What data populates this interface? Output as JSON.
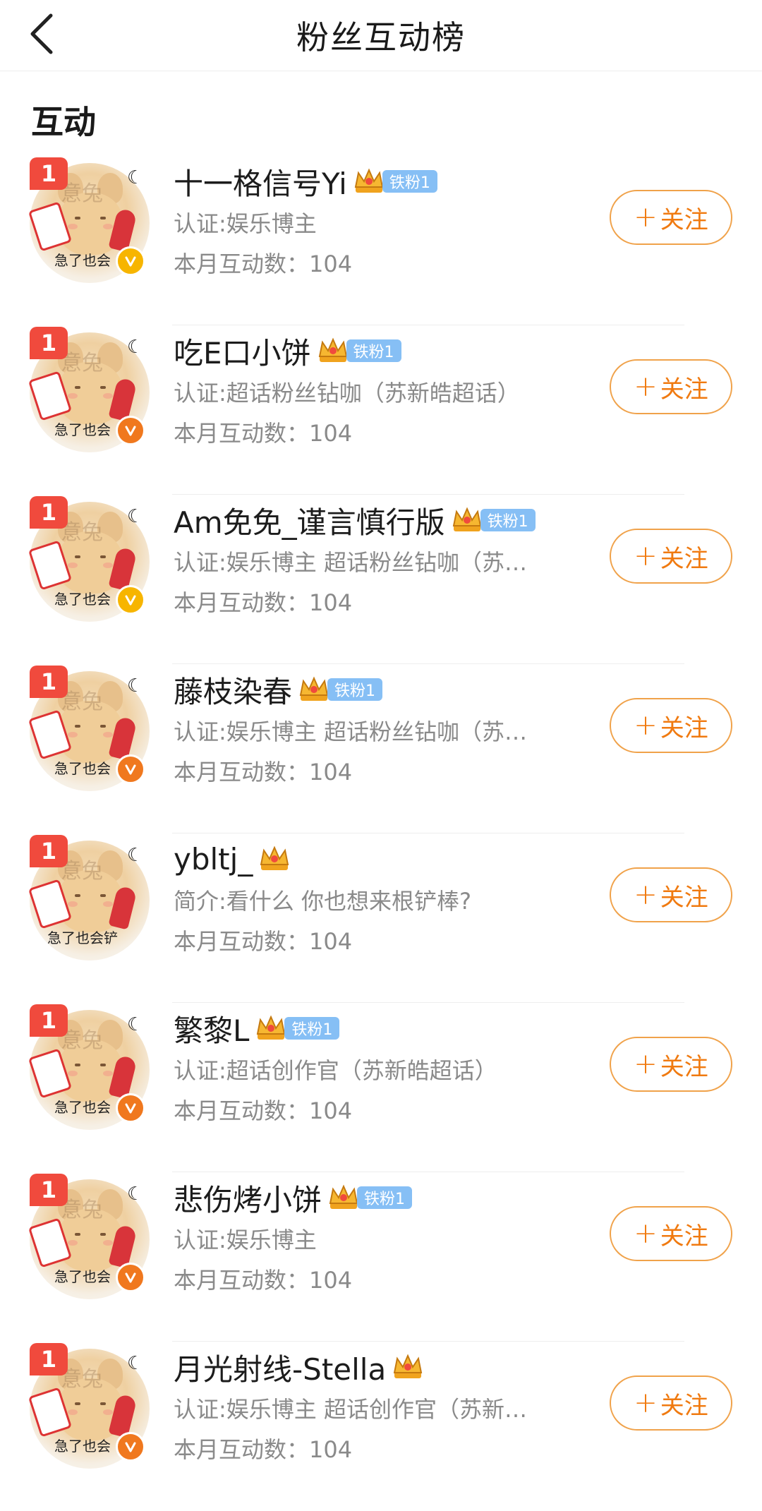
{
  "header": {
    "title": "粉丝互动榜"
  },
  "section": {
    "title": "互动"
  },
  "colors": {
    "accent": "#f07a10",
    "rank": "#f04a3d",
    "fan_tag": "#86bff5"
  },
  "follow_label": "关注",
  "items": [
    {
      "rank": "1",
      "avatar_caption": "急了也会",
      "avatar_watermark": "意兔",
      "verified_color": "gold",
      "name": "十一格信号Yi",
      "crown": "crown-icon",
      "fan_tag": "铁粉1",
      "desc": "认证:娱乐博主",
      "count": "本月互动数：104"
    },
    {
      "rank": "1",
      "avatar_caption": "急了也会",
      "avatar_watermark": "意兔",
      "verified_color": "orange",
      "name": "吃E口小饼",
      "crown": "crown-icon",
      "fan_tag": "铁粉1",
      "desc": "认证:超话粉丝钻咖（苏新皓超话）",
      "count": "本月互动数：104"
    },
    {
      "rank": "1",
      "avatar_caption": "急了也会",
      "avatar_watermark": "意兔",
      "verified_color": "gold",
      "name": "Am免免_谨言慎行版",
      "crown": "crown-icon",
      "fan_tag": "铁粉1",
      "desc": "认证:娱乐博主 超话粉丝钻咖（苏…",
      "count": "本月互动数：104"
    },
    {
      "rank": "1",
      "avatar_caption": "急了也会",
      "avatar_watermark": "意兔",
      "verified_color": "orange",
      "name": "藤枝染春",
      "crown": "crown-icon",
      "fan_tag": "铁粉1",
      "desc": "认证:娱乐博主 超话粉丝钻咖（苏…",
      "count": "本月互动数：104"
    },
    {
      "rank": "1",
      "avatar_caption": "急了也会铲",
      "avatar_watermark": "意兔",
      "verified_color": "none",
      "name": "ybltj_",
      "crown": "crown-icon",
      "fan_tag": "",
      "desc": "简介:看什么 你也想来根铲棒?",
      "count": "本月互动数：104"
    },
    {
      "rank": "1",
      "avatar_caption": "急了也会",
      "avatar_watermark": "意兔",
      "verified_color": "orange",
      "name": "繁黎L",
      "crown": "crown-icon",
      "fan_tag": "铁粉1",
      "desc": "认证:超话创作官（苏新皓超话）",
      "count": "本月互动数：104"
    },
    {
      "rank": "1",
      "avatar_caption": "急了也会",
      "avatar_watermark": "意兔",
      "verified_color": "orange",
      "name": "悲伤烤小饼",
      "crown": "crown-icon",
      "fan_tag": "铁粉1",
      "desc": "认证:娱乐博主",
      "count": "本月互动数：104"
    },
    {
      "rank": "1",
      "avatar_caption": "急了也会",
      "avatar_watermark": "意兔",
      "verified_color": "orange",
      "name": "月光射线-Stella",
      "crown": "crown-icon",
      "fan_tag": "",
      "desc": "认证:娱乐博主 超话创作官（苏新…",
      "count": "本月互动数：104"
    }
  ]
}
